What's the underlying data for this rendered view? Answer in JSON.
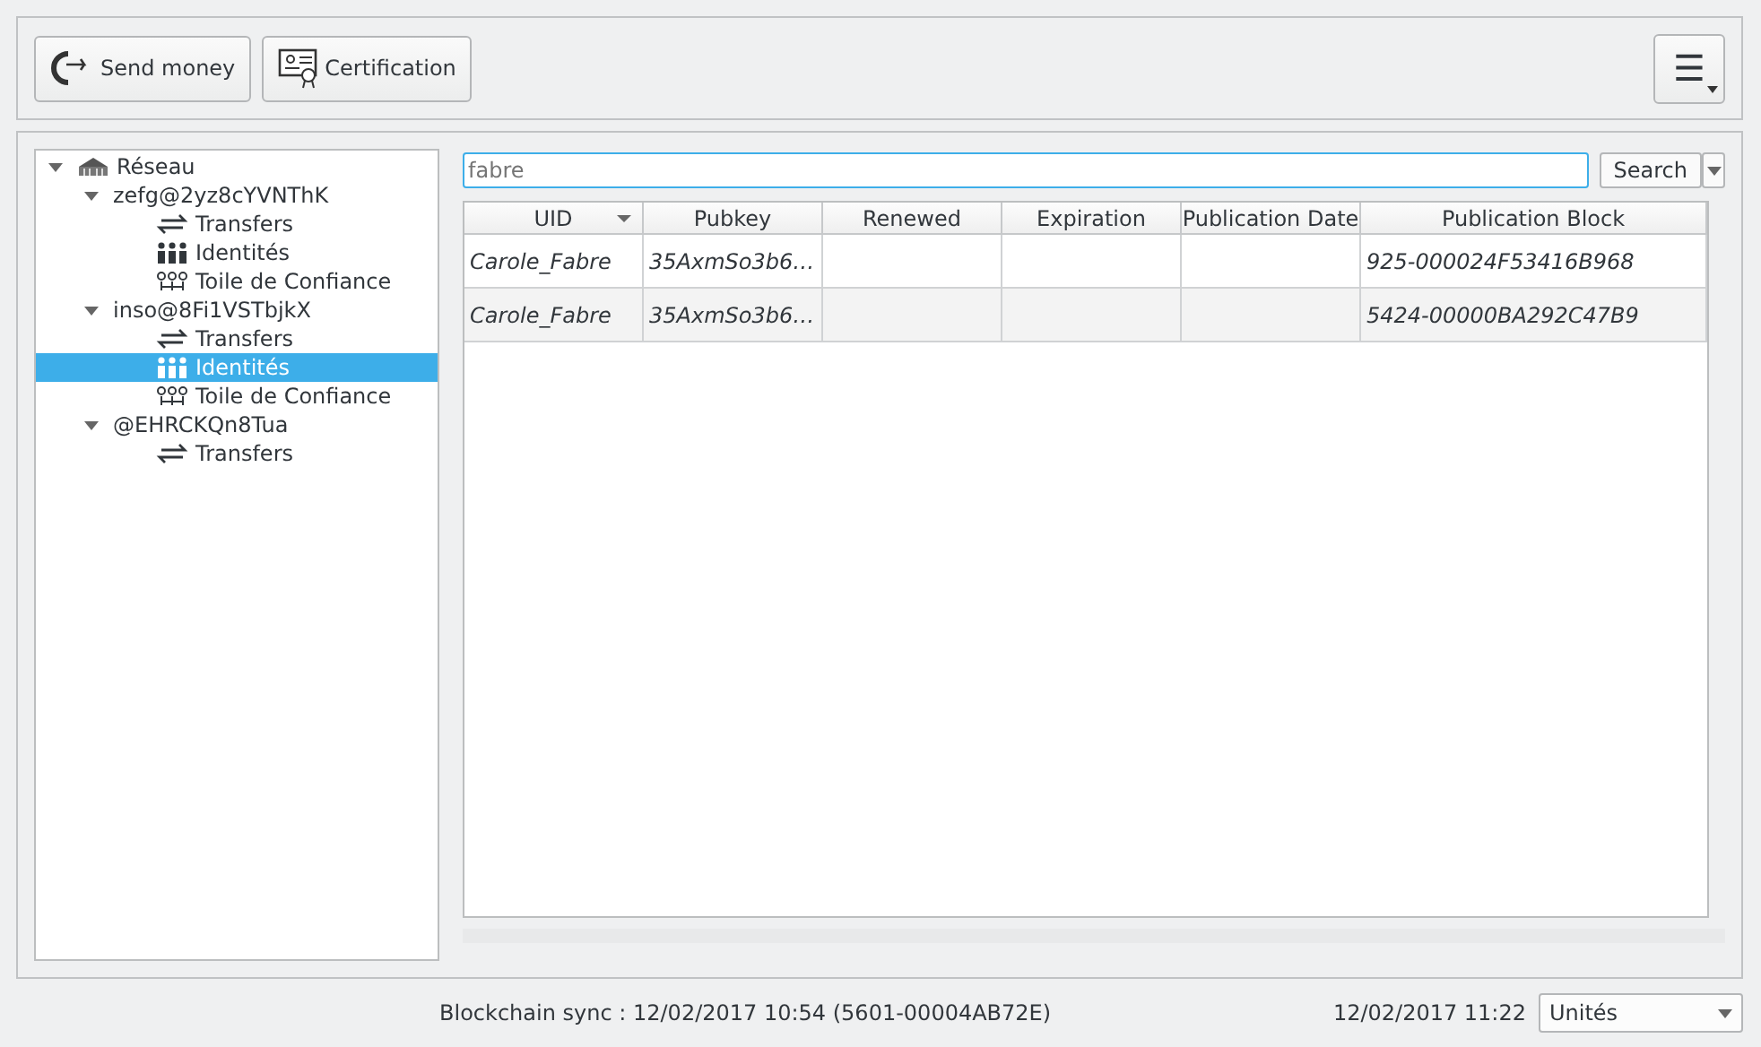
{
  "toolbar": {
    "buttons": [
      {
        "label": "Send money",
        "kind": "send"
      },
      {
        "label": "Certification",
        "kind": "cert"
      }
    ],
    "menu_button": {
      "label": "☰"
    }
  },
  "tree": [
    {
      "label": "Réseau",
      "kind": "network",
      "selected": false,
      "expanded": true,
      "children": [
        {
          "label": "zefg@2yz8cYVNThK",
          "selected": false,
          "expanded": true,
          "children": [
            {
              "label": "Transfers",
              "kind": "transfers",
              "selected": false
            },
            {
              "label": "Identités",
              "kind": "identities",
              "selected": false
            },
            {
              "label": "Toile de Confiance",
              "kind": "wot",
              "selected": false
            }
          ]
        },
        {
          "label": "inso@8Fi1VSTbjkX",
          "selected": false,
          "expanded": true,
          "children": [
            {
              "label": "Transfers",
              "kind": "transfers",
              "selected": false
            },
            {
              "label": "Identités",
              "kind": "identities",
              "selected": true
            },
            {
              "label": "Toile de Confiance",
              "kind": "wot",
              "selected": false
            }
          ]
        },
        {
          "label": "@EHRCKQn8Tua",
          "selected": false,
          "expanded": true,
          "children": [
            {
              "label": "Transfers",
              "kind": "transfers",
              "selected": false
            }
          ]
        }
      ]
    }
  ],
  "search": {
    "placeholder": "fabre",
    "button": "Search"
  },
  "table": {
    "columns": [
      {
        "label": "UID",
        "sorted": true
      },
      {
        "label": "Pubkey",
        "sorted": false
      },
      {
        "label": "Renewed",
        "sorted": false
      },
      {
        "label": "Expiration",
        "sorted": false
      },
      {
        "label": "Publication Date",
        "sorted": false
      },
      {
        "label": "Publication Block",
        "sorted": false
      }
    ],
    "rows": [
      [
        "Carole_Fabre",
        "35AxmSo3b6…",
        "",
        "",
        "",
        "925-000024F53416B968"
      ],
      [
        "Carole_Fabre",
        "35AxmSo3b6…",
        "",
        "",
        "",
        "5424-00000BA292C47B9"
      ]
    ]
  },
  "status_bar": {
    "sync": "Blockchain sync : 12/02/2017 10:54 (5601-00004AB72E)",
    "time": "12/02/2017 11:22",
    "unit": "Unités"
  }
}
